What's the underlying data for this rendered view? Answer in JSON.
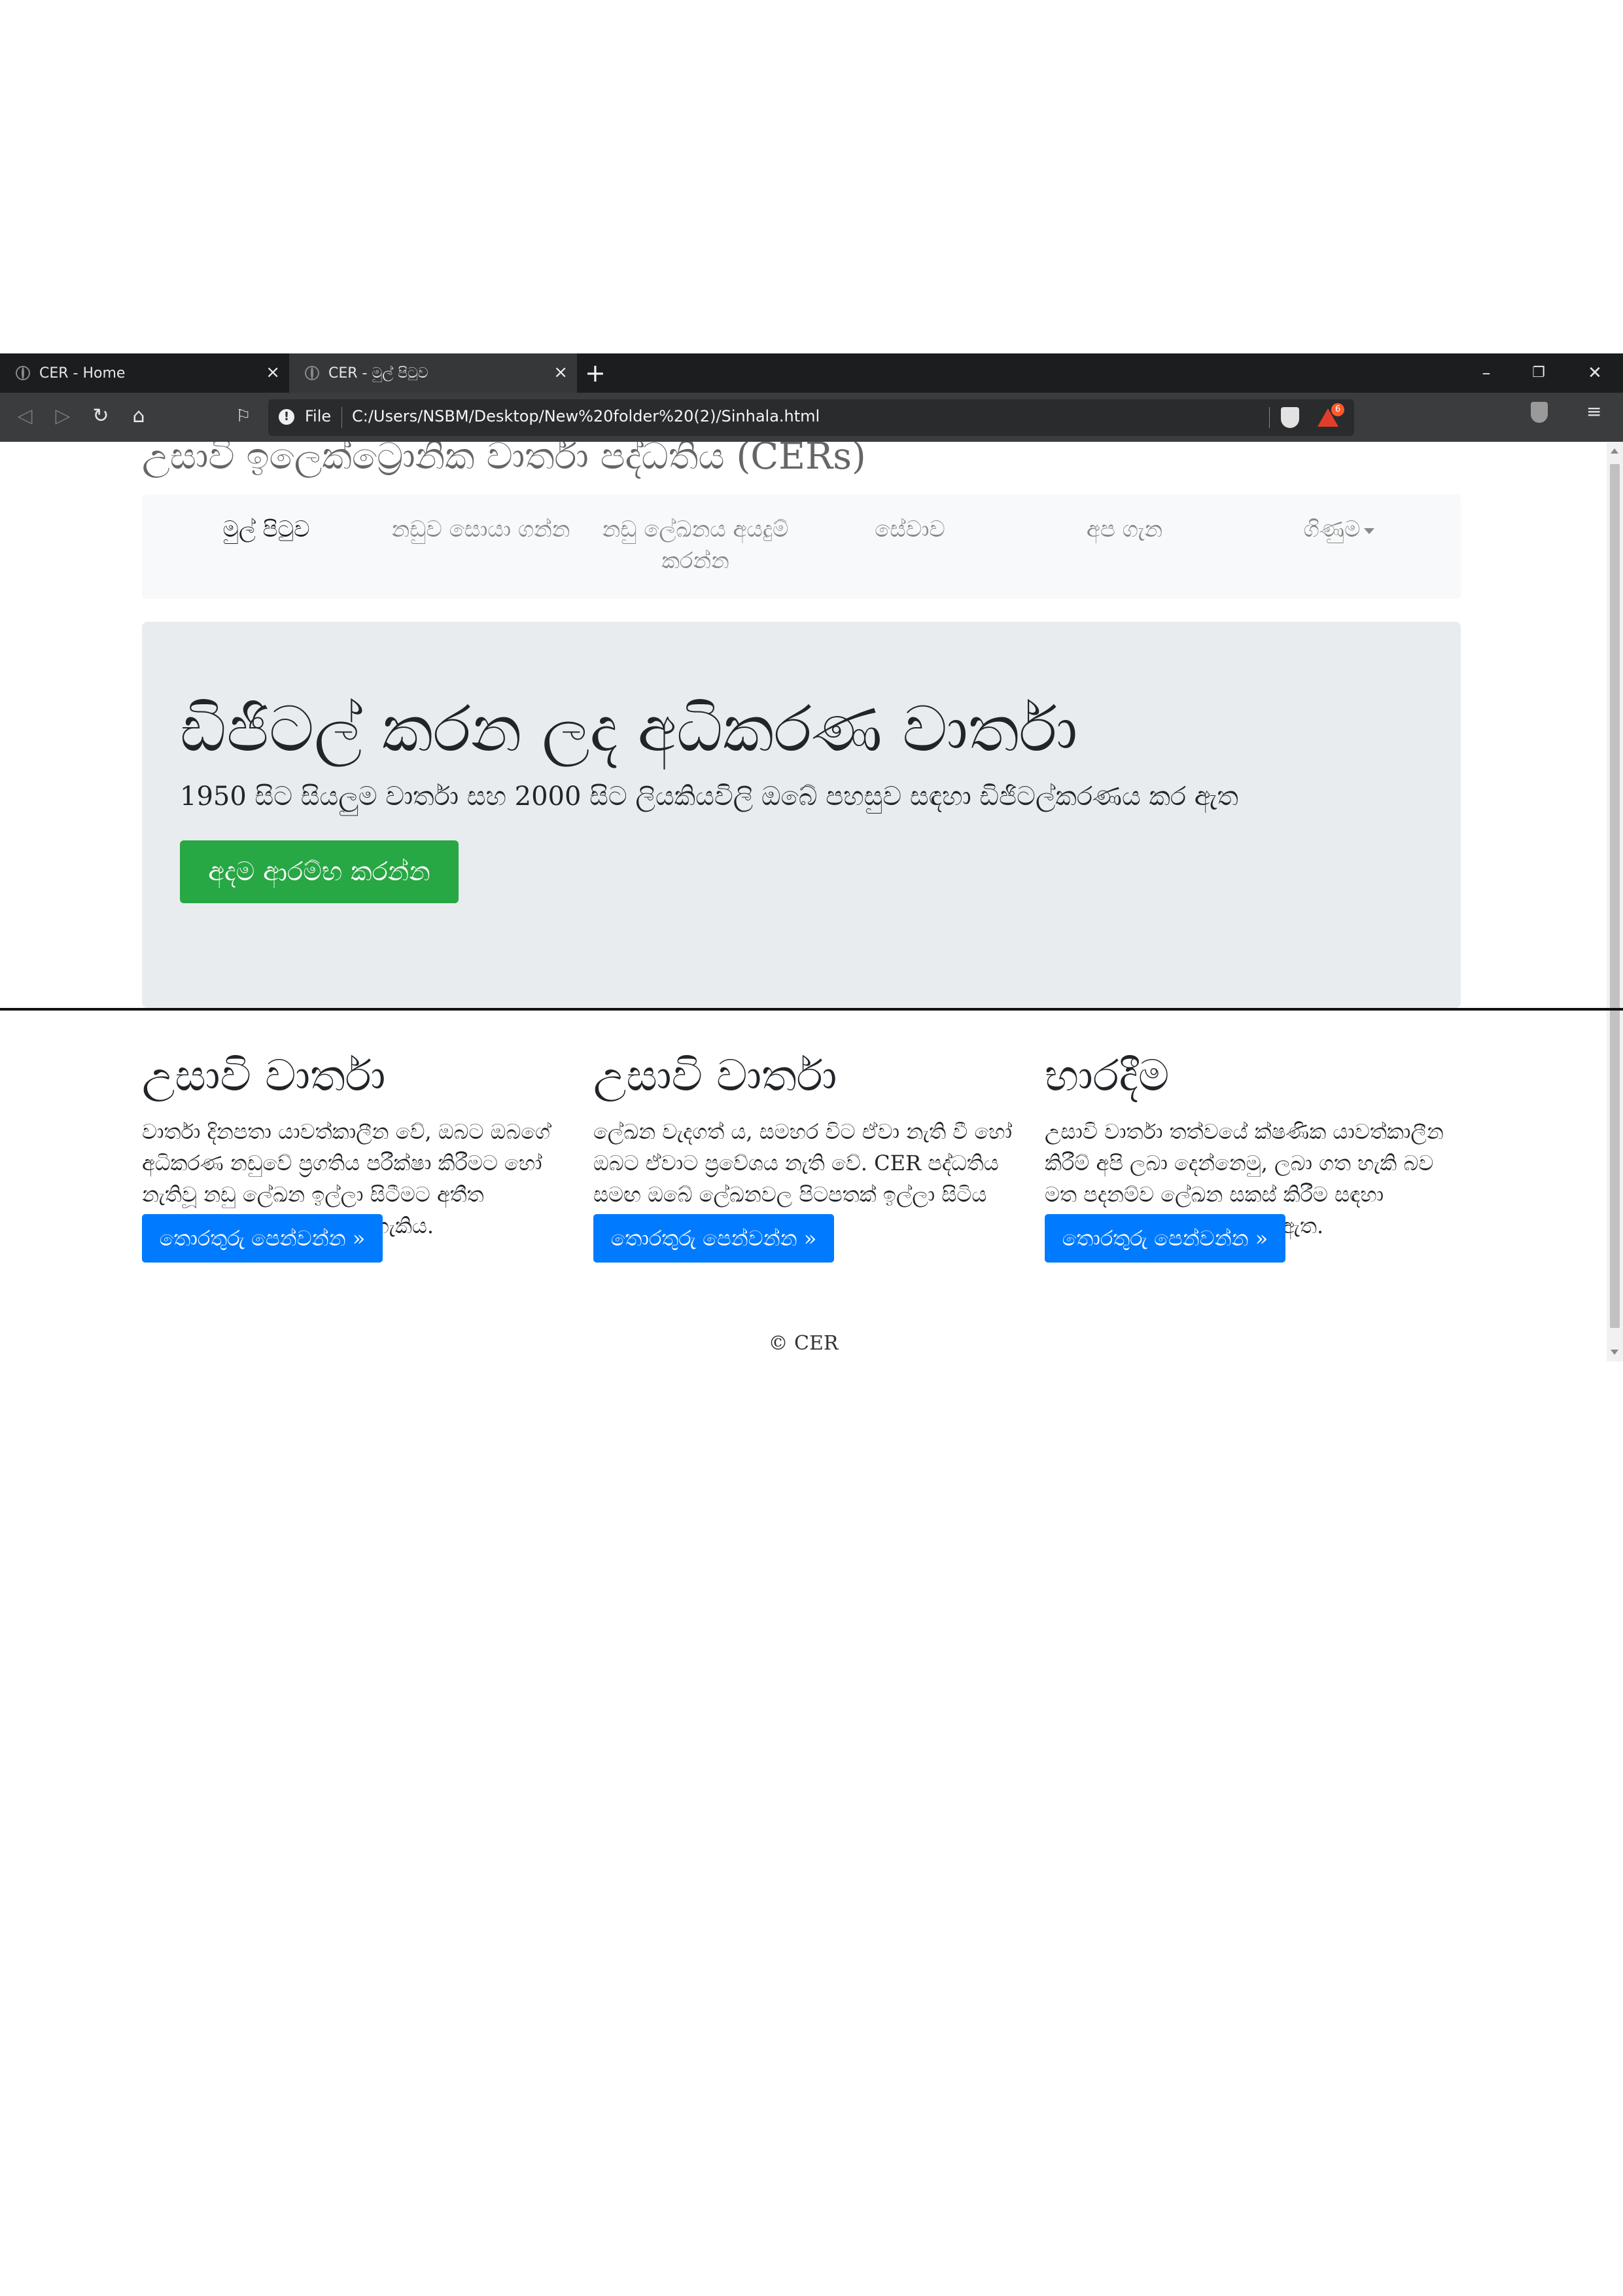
{
  "browser": {
    "tabs": [
      {
        "title": "CER - Home",
        "close": "×"
      },
      {
        "title": "CER - මුල් පිටුව",
        "close": "×"
      }
    ],
    "new_tab": "+",
    "window_controls": {
      "minimize": "–",
      "restore": "❐",
      "close": "✕"
    },
    "toolbar": {
      "back": "◁",
      "forward": "▷",
      "reload": "↻",
      "home": "⌂",
      "bookmark": "⚐",
      "info_icon": "!",
      "scheme": "File",
      "url": "C:/Users/NSBM/Desktop/New%20folder%20(2)/Sinhala.html",
      "rewards_badge": "6",
      "menu": "≡"
    }
  },
  "page": {
    "site_title": "උසාවි ඉලෙක්ට්‍රොනික වාර්තා පද්ධතිය (CERs)",
    "nav": {
      "home": "මුල් පිටුව",
      "find_case": "නඩුව සොයා ගන්න",
      "apply_docs": "නඩු ලේඛනය අයදුම් කරන්න",
      "services": "සේවාව",
      "about": "අප ගැන",
      "payment": "ගිණුම"
    },
    "jumbotron": {
      "title": "ඩිජිටල් කරන ලද අධිකරණ වාර්තා",
      "lead": "1950 සිට සියලුම වාර්තා සහ 2000 සිට ලියකියවිලි ඔබේ පහසුව සඳහා ඩිජිටල්කරණය කර ඇත",
      "button": "අදම ආරම්භ කරන්න"
    },
    "columns": [
      {
        "heading": "උසාවි වාර්තා",
        "text": "වාර්තා දිනපතා යාවත්කාලීන වේ, ඔබට ඔබගේ අධිකරණ නඩුවේ ප්‍රගතිය පරීක්ෂා කිරීමට හෝ නැතිවූ නඩු ලේඛන ඉල්ලා සිටීමට අතීත අධිකරණ නඩු සොයා ගත හැකිය.",
        "button": "තොරතුරු පෙන්වන්න »"
      },
      {
        "heading": "උසාවි වාර්තා",
        "text": "ලේඛන වැදගත් ය, සමහර විට ඒවා නැති වී හෝ ඔබට ඒවාට ප්‍රවේශය නැති වේ. CER පද්ධතිය සමඟ ඔබේ ලේඛනවල පිටපතක් ඉල්ලා සිටිය හැකිය.",
        "button": "තොරතුරු පෙන්වන්න »"
      },
      {
        "heading": "භාරදීම",
        "text": "උසාවි වාර්තා තත්වයේ ක්ෂණික යාවත්කාලීන කිරීම් අපි ලබා දෙන්නෙමු, ලබා ගත හැකි බව මත පදනම්ව ලේඛන සකස් කිරීම සඳහා වැඩකරන දින 3 ක් ගතවනු ඇත.",
        "button": "තොරතුරු පෙන්වන්න »"
      }
    ],
    "footer": "© CER"
  },
  "colors": {
    "tab_strip": "#1c1d1f",
    "toolbar": "#3a3c3e",
    "navbar_bg": "#f8f9fa",
    "jumbotron_bg": "#e9ecef",
    "success_button": "#28a745",
    "primary_button": "#007bff"
  }
}
